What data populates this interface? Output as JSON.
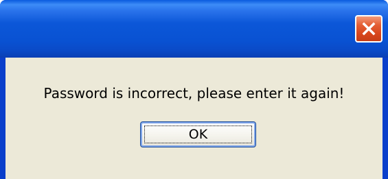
{
  "dialog": {
    "title": "",
    "close_icon": "close-icon",
    "message": "Password is incorrect, please enter it again!",
    "ok_label": "OK"
  },
  "colors": {
    "titlebar": "#0a52d3",
    "close_button": "#d8461c",
    "client_background": "#ece9d8",
    "button_border": "#1c4c9a"
  }
}
